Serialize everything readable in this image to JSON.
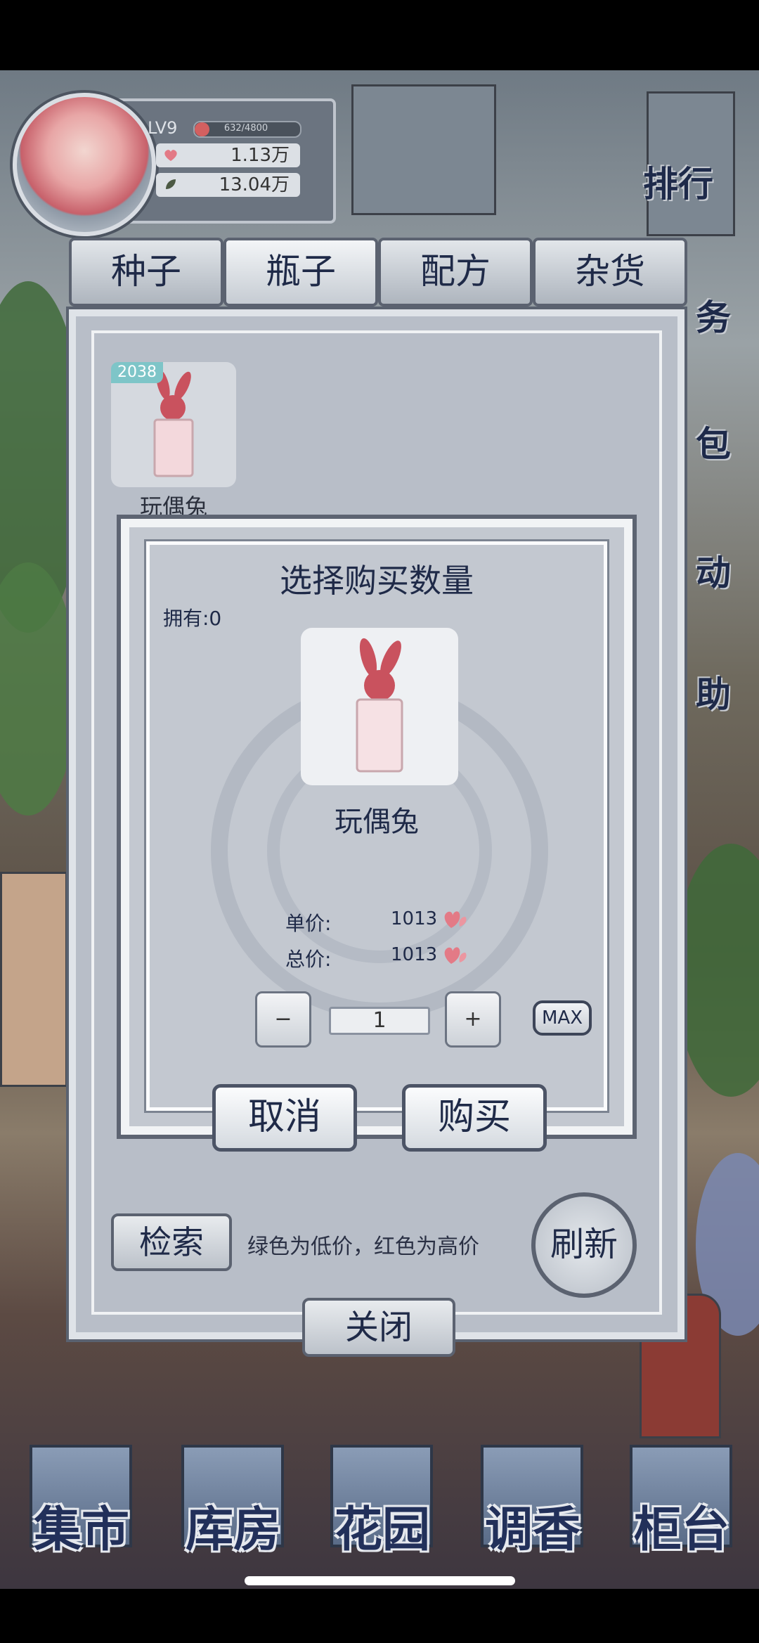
{
  "player": {
    "level": "LV9",
    "xp_text": "632/4800",
    "petals": "1.13万",
    "leaves": "13.04万"
  },
  "right_menu": {
    "rank": "排行",
    "task": "务",
    "bag": "包",
    "event": "动",
    "help": "助"
  },
  "tabs": [
    {
      "label": "种子"
    },
    {
      "label": "瓶子"
    },
    {
      "label": "配方"
    },
    {
      "label": "杂货"
    }
  ],
  "active_tab": "瓶子",
  "shop_items": [
    {
      "badge": "2038",
      "name": "玩偶兔"
    }
  ],
  "purchase_dialog": {
    "title": "选择购买数量",
    "owned_label": "拥有:0",
    "item_name": "玩偶兔",
    "unit_price_label": "单价:",
    "unit_price_value": "1013",
    "total_price_label": "总价:",
    "total_price_value": "1013",
    "decrement": "−",
    "quantity": "1",
    "increment": "+",
    "max": "MAX",
    "cancel": "取消",
    "buy": "购买"
  },
  "shop_footer": {
    "search": "检索",
    "hint": "绿色为低价，红色为高价",
    "refresh": "刷新",
    "close": "关闭"
  },
  "bottom_nav": [
    {
      "label": "集市"
    },
    {
      "label": "库房"
    },
    {
      "label": "花园"
    },
    {
      "label": "调香"
    },
    {
      "label": "柜台"
    }
  ],
  "colors": {
    "accent_text": "#1f2a48",
    "heart": "#e37a86"
  }
}
